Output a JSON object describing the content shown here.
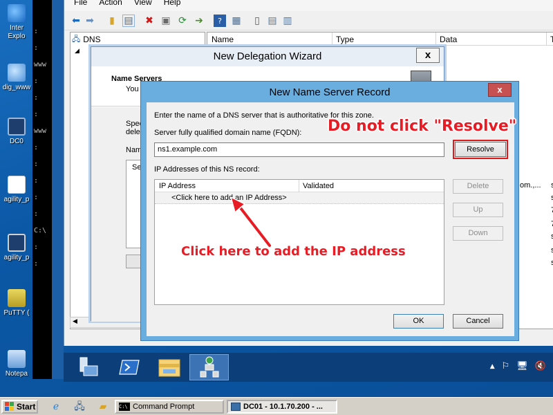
{
  "host_desktop": {
    "icons": [
      {
        "label": "Inter\nExplo",
        "icon": "internet-explorer-icon",
        "color": "#2d8ee0"
      },
      {
        "label": "dig_www",
        "icon": "network-icon",
        "color": "#4a9ee3"
      },
      {
        "label": "DC0",
        "icon": "computer-icon",
        "color": "#1e3f6e"
      },
      {
        "label": "agility_p",
        "icon": "document-icon",
        "color": "#ffffff"
      },
      {
        "label": "agility_p",
        "icon": "application-icon",
        "color": "#1e3f6e"
      },
      {
        "label": "PuTTY (",
        "icon": "putty-icon",
        "color": "#d8c247"
      },
      {
        "label": "Notepa",
        "icon": "notepad-icon",
        "color": "#6a9ed8"
      }
    ],
    "terminal_lines": [
      ":",
      ":",
      "www",
      ":",
      ":",
      ":",
      "www",
      ":",
      ":",
      ":",
      ":",
      ":",
      "C:\\",
      ":",
      ":"
    ]
  },
  "dns_window": {
    "menu": [
      "File",
      "Action",
      "View",
      "Help"
    ],
    "tree_root": "DNS",
    "columns": [
      "Name",
      "Type",
      "Data",
      "T"
    ],
    "right_entries": [
      {
        "data": "om.,...",
        "t": "st"
      },
      {
        "data": "",
        "t": "st"
      },
      {
        "data": "",
        "t": "7"
      },
      {
        "data": "",
        "t": "7"
      },
      {
        "data": "",
        "t": "st"
      },
      {
        "data": "",
        "t": "st"
      },
      {
        "data": "",
        "t": "st"
      }
    ]
  },
  "wizard": {
    "title": "New Delegation Wizard",
    "close_label": "x",
    "header_title": "Name Servers",
    "header_sub": "You",
    "body_line1": "Spec",
    "body_line2": "dele",
    "body_line3": "Nam",
    "list_text": "Ser"
  },
  "ns_dialog": {
    "title": "New Name Server Record",
    "close_label": "x",
    "instruction": "Enter the name of a DNS server that is authoritative for this zone.",
    "fqdn_label": "Server fully qualified domain name (FQDN):",
    "fqdn_value": "ns1.example.com",
    "resolve_label": "Resolve",
    "ip_label": "IP Addresses of this NS record:",
    "ip_columns": [
      "IP Address",
      "Validated"
    ],
    "ip_row_placeholder": "<Click here to add an IP Address>",
    "delete_label": "Delete",
    "up_label": "Up",
    "down_label": "Down",
    "ok_label": "OK",
    "cancel_label": "Cancel"
  },
  "annotations": {
    "resolve_warning": "Do not click \"Resolve\"",
    "add_ip_hint": "Click here to add the IP address"
  },
  "vm_taskbar": {
    "items": [
      "server-manager-icon",
      "powershell-icon",
      "file-explorer-icon",
      "dns-manager-icon"
    ],
    "tray": [
      "▲",
      "⚐",
      "🖥",
      "🔇"
    ]
  },
  "host_taskbar": {
    "start_label": "Start",
    "tasks": [
      {
        "label": "Command Prompt",
        "active": false
      },
      {
        "label": "DC01 - 10.1.70.200 - ...",
        "active": true
      }
    ]
  },
  "colors": {
    "annotation_red": "#e81c24",
    "dialog_border_blue": "#6aaddf",
    "close_red": "#c75050",
    "vm_taskbar": "#0c3f7a"
  }
}
